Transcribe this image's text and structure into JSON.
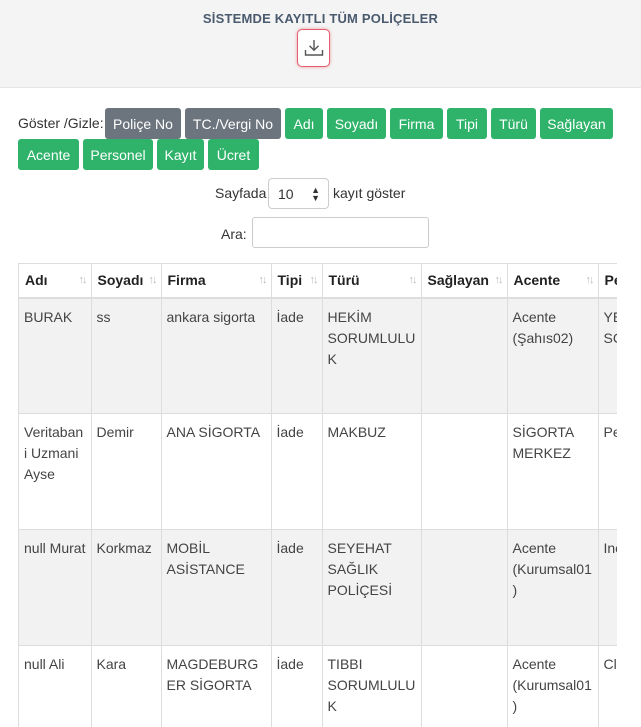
{
  "header": {
    "title": "SİSTEMDE KAYITLI TÜM POLİÇELER",
    "download_icon": "download-icon"
  },
  "toggles": {
    "label": "Göster /Gizle:",
    "row1": [
      {
        "label": "Poliçe No",
        "active": false
      },
      {
        "label": "TC./Vergi No",
        "active": false
      },
      {
        "label": "Adı",
        "active": true
      },
      {
        "label": "Soyadı",
        "active": true
      },
      {
        "label": "Firma",
        "active": true
      },
      {
        "label": "Tipi",
        "active": true
      },
      {
        "label": "Türü",
        "active": true
      },
      {
        "label": "Sağlayan",
        "active": true
      }
    ],
    "row2": [
      {
        "label": "Acente",
        "active": true
      },
      {
        "label": "Personel",
        "active": true
      },
      {
        "label": "Kayıt",
        "active": true
      },
      {
        "label": "Ücret",
        "active": true
      }
    ]
  },
  "length_menu": {
    "prefix": "Sayfada",
    "value": "10",
    "suffix": "kayıt göster"
  },
  "search": {
    "label": "Ara:",
    "value": ""
  },
  "table": {
    "columns": [
      "Adı",
      "Soyadı",
      "Firma",
      "Tipi",
      "Türü",
      "Sağlayan",
      "Acente",
      "Pe"
    ],
    "rows": [
      [
        "BURAK",
        "ss",
        "ankara sigorta",
        "İade",
        "HEKİM SORUMLULUK",
        "",
        "Acente (Şahıs02)",
        "YE Bİ SC"
      ],
      [
        "Veritabani Uzmani Ayse",
        "Demir",
        "ANA SİGORTA",
        "İade",
        "MAKBUZ",
        "",
        "SİGORTA MERKEZ",
        "Pe"
      ],
      [
        "null Murat",
        "Korkmaz",
        "MOBİL ASİSTANCE",
        "İade",
        "SEYEHAT SAĞLIK POLİÇESİ",
        "",
        "Acente (Kurumsal01)",
        "Ine"
      ],
      [
        "null Ali",
        "Kara",
        "MAGDEBURGER SİGORTA",
        "İade",
        "TIBBI SORUMLULUK",
        "",
        "Acente (Kurumsal01)",
        "Cla Sp"
      ]
    ]
  },
  "colors": {
    "active_toggle": "#2fb36a",
    "inactive_toggle": "#6c757d",
    "download_border": "#e4606d"
  }
}
